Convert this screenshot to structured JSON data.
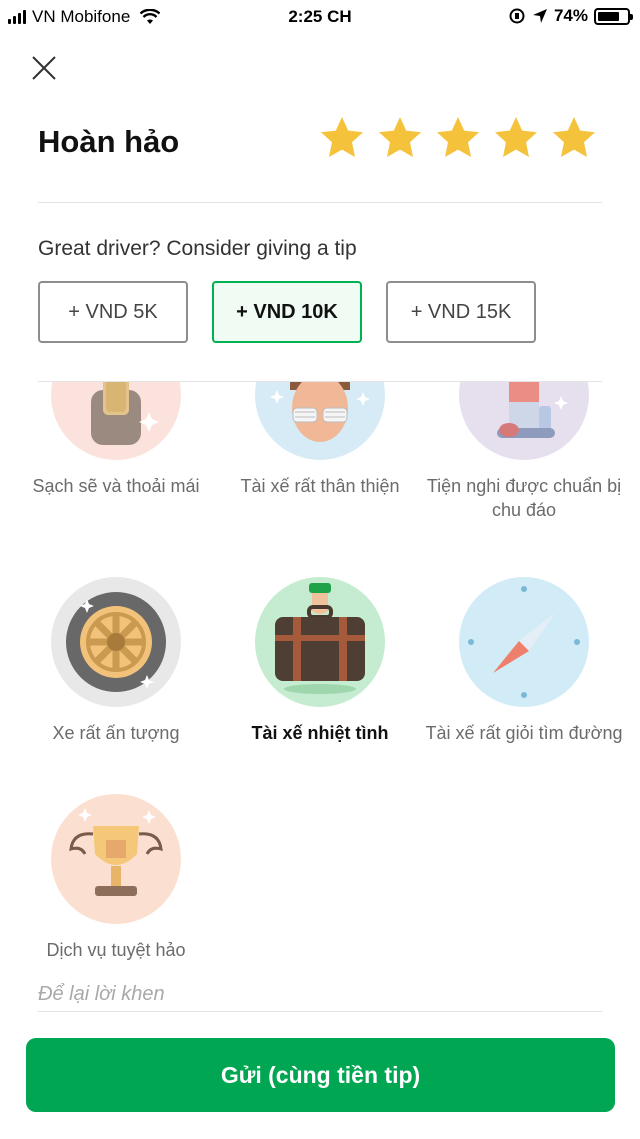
{
  "status_bar": {
    "carrier": "VN Mobifone",
    "time": "2:25 CH",
    "battery_percent_label": "74%",
    "battery_level": 0.74
  },
  "rating": {
    "title": "Hoàn hảo",
    "stars": 5,
    "max_stars": 5,
    "star_color": "#f5c33b"
  },
  "tip": {
    "prompt": "Great driver? Consider giving a tip",
    "options": [
      {
        "label": "+ VND 5K",
        "selected": false
      },
      {
        "label": "+ VND 10K",
        "selected": true
      },
      {
        "label": "+ VND 15K",
        "selected": false
      }
    ]
  },
  "compliments": [
    {
      "label": "Sạch sẽ và thoải mái",
      "icon": "seat-icon",
      "selected": false
    },
    {
      "label": "Tài xế rất thân thiện",
      "icon": "friendly-driver-icon",
      "selected": false
    },
    {
      "label": "Tiện nghi được chuẩn bị chu đáo",
      "icon": "amenities-icon",
      "selected": false
    },
    {
      "label": "Xe rất ấn tượng",
      "icon": "wheel-icon",
      "selected": false
    },
    {
      "label": "Tài xế nhiệt tình",
      "icon": "luggage-icon",
      "selected": true
    },
    {
      "label": "Tài xế rất giỏi tìm đường",
      "icon": "compass-icon",
      "selected": false
    },
    {
      "label": "Dịch vụ tuyệt hảo",
      "icon": "trophy-icon",
      "selected": false
    }
  ],
  "praise_input": {
    "placeholder": "Để lại lời khen",
    "value": ""
  },
  "submit": {
    "label": "Gửi (cùng tiền tip)",
    "color": "#00a651"
  },
  "colors": {
    "accent_green": "#00b14f"
  }
}
